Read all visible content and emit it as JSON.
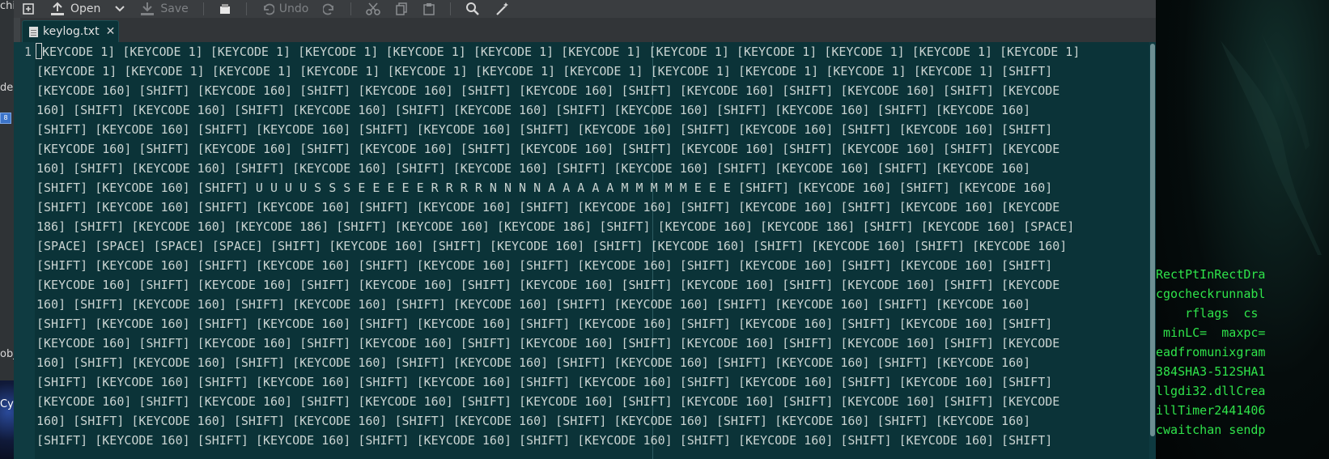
{
  "left_strip": {
    "fragments": [
      "chi",
      "der",
      "obj",
      "Cy"
    ]
  },
  "toolbar": {
    "open_label": "Open",
    "save_label": "Save",
    "undo_label": "Undo"
  },
  "tab": {
    "filename": "keylog.txt",
    "close_glyph": "✕"
  },
  "editor": {
    "line_number": "1",
    "lines": [
      "KEYCODE 1] [KEYCODE 1] [KEYCODE 1] [KEYCODE 1] [KEYCODE 1] [KEYCODE 1] [KEYCODE 1] [KEYCODE 1] [KEYCODE 1] [KEYCODE 1] [KEYCODE 1] [KEYCODE 1]",
      "[KEYCODE 1] [KEYCODE 1] [KEYCODE 1] [KEYCODE 1] [KEYCODE 1] [KEYCODE 1] [KEYCODE 1] [KEYCODE 1] [KEYCODE 1] [KEYCODE 1] [KEYCODE 1] [SHIFT]",
      "[KEYCODE 160] [SHIFT] [KEYCODE 160] [SHIFT] [KEYCODE 160] [SHIFT] [KEYCODE 160] [SHIFT] [KEYCODE 160] [SHIFT] [KEYCODE 160] [SHIFT] [KEYCODE",
      "160] [SHIFT] [KEYCODE 160] [SHIFT] [KEYCODE 160] [SHIFT] [KEYCODE 160] [SHIFT] [KEYCODE 160] [SHIFT] [KEYCODE 160] [SHIFT] [KEYCODE 160]",
      "[SHIFT] [KEYCODE 160] [SHIFT] [KEYCODE 160] [SHIFT] [KEYCODE 160] [SHIFT] [KEYCODE 160] [SHIFT] [KEYCODE 160] [SHIFT] [KEYCODE 160] [SHIFT]",
      "[KEYCODE 160] [SHIFT] [KEYCODE 160] [SHIFT] [KEYCODE 160] [SHIFT] [KEYCODE 160] [SHIFT] [KEYCODE 160] [SHIFT] [KEYCODE 160] [SHIFT] [KEYCODE",
      "160] [SHIFT] [KEYCODE 160] [SHIFT] [KEYCODE 160] [SHIFT] [KEYCODE 160] [SHIFT] [KEYCODE 160] [SHIFT] [KEYCODE 160] [SHIFT] [KEYCODE 160]",
      "[SHIFT] [KEYCODE 160] [SHIFT] U U U U S S S E E E E E R R R R N N N N A A A A A M M M M M E E E [SHIFT] [KEYCODE 160] [SHIFT] [KEYCODE 160]",
      "[SHIFT] [KEYCODE 160] [SHIFT] [KEYCODE 160] [SHIFT] [KEYCODE 160] [SHIFT] [KEYCODE 160] [SHIFT] [KEYCODE 160] [SHIFT] [KEYCODE 160] [KEYCODE",
      "186] [SHIFT] [KEYCODE 160] [KEYCODE 186] [SHIFT] [KEYCODE 160] [KEYCODE 186] [SHIFT] [KEYCODE 160] [KEYCODE 186] [SHIFT] [KEYCODE 160] [SPACE]",
      "[SPACE] [SPACE] [SPACE] [SPACE] [SHIFT] [KEYCODE 160] [SHIFT] [KEYCODE 160] [SHIFT] [KEYCODE 160] [SHIFT] [KEYCODE 160] [SHIFT] [KEYCODE 160]",
      "[SHIFT] [KEYCODE 160] [SHIFT] [KEYCODE 160] [SHIFT] [KEYCODE 160] [SHIFT] [KEYCODE 160] [SHIFT] [KEYCODE 160] [SHIFT] [KEYCODE 160] [SHIFT]",
      "[KEYCODE 160] [SHIFT] [KEYCODE 160] [SHIFT] [KEYCODE 160] [SHIFT] [KEYCODE 160] [SHIFT] [KEYCODE 160] [SHIFT] [KEYCODE 160] [SHIFT] [KEYCODE",
      "160] [SHIFT] [KEYCODE 160] [SHIFT] [KEYCODE 160] [SHIFT] [KEYCODE 160] [SHIFT] [KEYCODE 160] [SHIFT] [KEYCODE 160] [SHIFT] [KEYCODE 160]",
      "[SHIFT] [KEYCODE 160] [SHIFT] [KEYCODE 160] [SHIFT] [KEYCODE 160] [SHIFT] [KEYCODE 160] [SHIFT] [KEYCODE 160] [SHIFT] [KEYCODE 160] [SHIFT]",
      "[KEYCODE 160] [SHIFT] [KEYCODE 160] [SHIFT] [KEYCODE 160] [SHIFT] [KEYCODE 160] [SHIFT] [KEYCODE 160] [SHIFT] [KEYCODE 160] [SHIFT] [KEYCODE",
      "160] [SHIFT] [KEYCODE 160] [SHIFT] [KEYCODE 160] [SHIFT] [KEYCODE 160] [SHIFT] [KEYCODE 160] [SHIFT] [KEYCODE 160] [SHIFT] [KEYCODE 160]",
      "[SHIFT] [KEYCODE 160] [SHIFT] [KEYCODE 160] [SHIFT] [KEYCODE 160] [SHIFT] [KEYCODE 160] [SHIFT] [KEYCODE 160] [SHIFT] [KEYCODE 160] [SHIFT]",
      "[KEYCODE 160] [SHIFT] [KEYCODE 160] [SHIFT] [KEYCODE 160] [SHIFT] [KEYCODE 160] [SHIFT] [KEYCODE 160] [SHIFT] [KEYCODE 160] [SHIFT] [KEYCODE",
      "160] [SHIFT] [KEYCODE 160] [SHIFT] [KEYCODE 160] [SHIFT] [KEYCODE 160] [SHIFT] [KEYCODE 160] [SHIFT] [KEYCODE 160] [SHIFT] [KEYCODE 160]",
      "[SHIFT] [KEYCODE 160] [SHIFT] [KEYCODE 160] [SHIFT] [KEYCODE 160] [SHIFT] [KEYCODE 160] [SHIFT] [KEYCODE 160] [SHIFT] [KEYCODE 160] [SHIFT]"
    ]
  },
  "terminal": {
    "lines": [
      "RectPtInRectDra",
      "cgocheckrunnabl",
      "    rflags  cs",
      " minLC=  maxpc=",
      "eadfromunixgram",
      "384SHA3-512SHA1",
      "llgdi32.dllCrea",
      "illTimer2441406",
      "cwaitchan sendp"
    ]
  },
  "colors": {
    "editor_bg": "#0b3338",
    "editor_text": "#c9d3d1",
    "terminal_green": "#2fe34a",
    "toolbar_bg": "#3a3d40"
  }
}
